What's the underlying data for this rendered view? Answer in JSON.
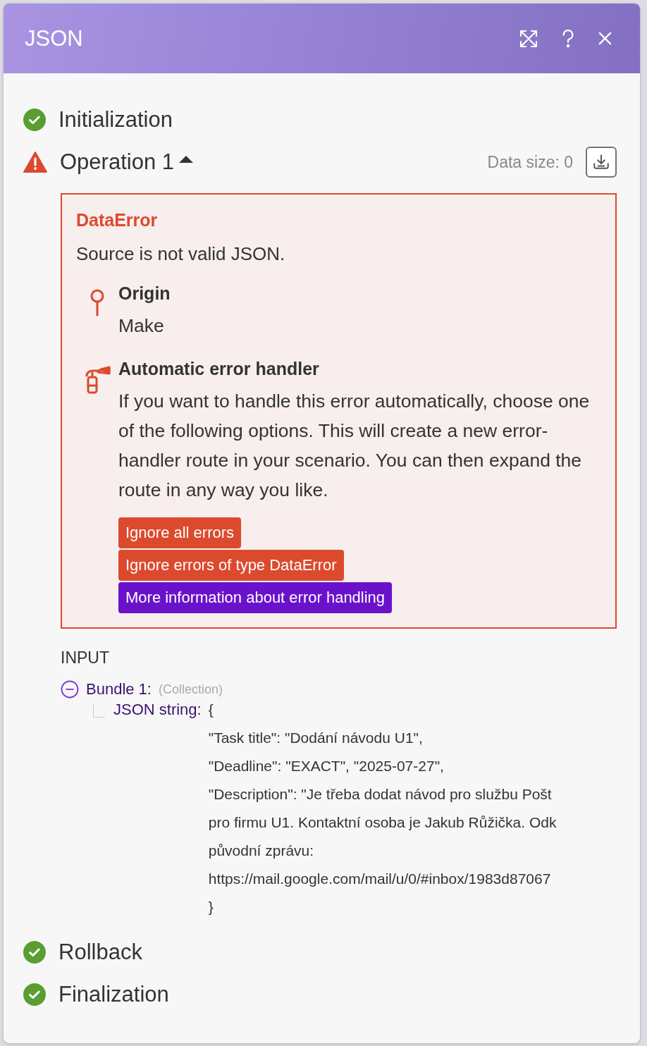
{
  "header": {
    "title": "JSON"
  },
  "stages": [
    {
      "label": "Initialization",
      "kind": "success"
    },
    {
      "label": "Operation 1",
      "kind": "warning",
      "expanded": true,
      "data_size": "Data size: 0",
      "error": {
        "name": "DataError",
        "message": "Source is not valid JSON.",
        "sections": [
          {
            "kind": "origin",
            "title": "Origin",
            "text": "Make"
          },
          {
            "kind": "handler",
            "title": "Automatic error handler",
            "text": "If you want to handle this error automatically, choose one of the following options. This will create a new error-handler route in your scenario. You can then expand the route in any way you like."
          }
        ],
        "actions": [
          {
            "label": "Ignore all errors",
            "kind": "danger"
          },
          {
            "label": "Ignore errors of type DataError",
            "kind": "danger"
          },
          {
            "label": "More information about error handling",
            "kind": "info"
          }
        ]
      },
      "input": {
        "heading": "INPUT",
        "bundles": [
          {
            "label": "Bundle 1:",
            "type": "(Collection)",
            "expanded": true,
            "children": [
              {
                "key": "JSON string:",
                "lines": [
                  "{",
                  "\"Task title\": \"Dodání návodu U1\",",
                  "\"Deadline\": \"EXACT\", \"2025-07-27\",",
                  "\"Description\": \"Je třeba dodat návod pro službu Pošt",
                  "pro firmu U1. Kontaktní osoba je Jakub Růžička. Odk",
                  "původní zprávu:",
                  "https://mail.google.com/mail/u/0/#inbox/1983d87067",
                  "}"
                ]
              }
            ]
          }
        ]
      }
    },
    {
      "label": "Rollback",
      "kind": "success"
    },
    {
      "label": "Finalization",
      "kind": "success"
    }
  ]
}
